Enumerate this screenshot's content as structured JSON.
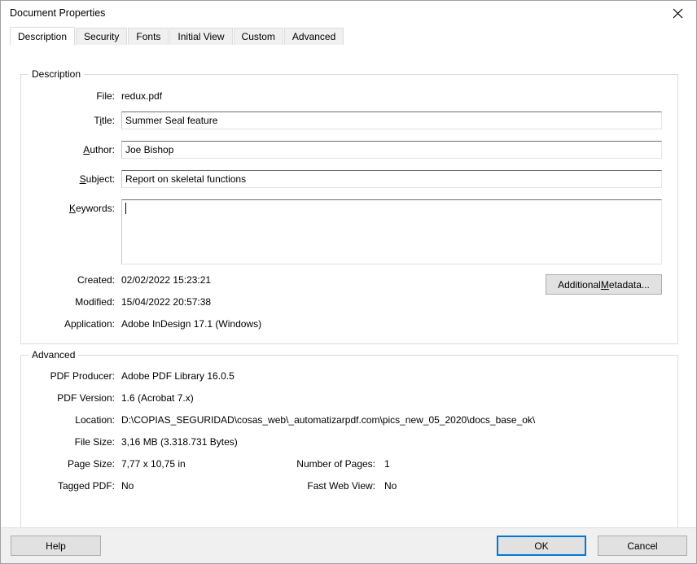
{
  "window": {
    "title": "Document Properties",
    "close_icon": "close-icon"
  },
  "tabs": [
    {
      "label": "Description",
      "selected": true
    },
    {
      "label": "Security",
      "selected": false
    },
    {
      "label": "Fonts",
      "selected": false
    },
    {
      "label": "Initial View",
      "selected": false
    },
    {
      "label": "Custom",
      "selected": false
    },
    {
      "label": "Advanced",
      "selected": false
    }
  ],
  "description": {
    "group_title": "Description",
    "file_label": "File:",
    "file_value": "redux.pdf",
    "title_label_pre": "T",
    "title_label_accel": "i",
    "title_label_post": "tle:",
    "title_value": "Summer Seal feature",
    "author_label_accel": "A",
    "author_label_post": "uthor:",
    "author_value": "Joe Bishop",
    "subject_label_accel": "S",
    "subject_label_post": "ubject:",
    "subject_value": "Report on skeletal functions",
    "keywords_label_accel": "K",
    "keywords_label_post": "eywords:",
    "keywords_value": "",
    "created_label": "Created:",
    "created_value": "02/02/2022 15:23:21",
    "modified_label": "Modified:",
    "modified_value": "15/04/2022 20:57:38",
    "application_label": "Application:",
    "application_value": "Adobe InDesign 17.1 (Windows)",
    "additional_metadata_pre": "Additional ",
    "additional_metadata_accel": "M",
    "additional_metadata_post": "etadata..."
  },
  "advanced": {
    "group_title": "Advanced",
    "pdf_producer_label": "PDF Producer:",
    "pdf_producer_value": "Adobe PDF Library 16.0.5",
    "pdf_version_label": "PDF Version:",
    "pdf_version_value": "1.6 (Acrobat 7.x)",
    "location_label": "Location:",
    "location_value": "D:\\COPIAS_SEGURIDAD\\cosas_web\\_automatizarpdf.com\\pics_new_05_2020\\docs_base_ok\\",
    "file_size_label": "File Size:",
    "file_size_value": "3,16 MB (3.318.731 Bytes)",
    "page_size_label": "Page Size:",
    "page_size_value": "7,77 x 10,75 in",
    "number_of_pages_label": "Number of Pages:",
    "number_of_pages_value": "1",
    "tagged_pdf_label": "Tagged PDF:",
    "tagged_pdf_value": "No",
    "fast_web_view_label": "Fast Web View:",
    "fast_web_view_value": "No"
  },
  "footer": {
    "help_label": "Help",
    "ok_label": "OK",
    "cancel_label": "Cancel"
  },
  "colors": {
    "accent": "#0078d7",
    "dialog_bg": "#ffffff",
    "footer_bg": "#f0f0f0",
    "button_bg": "#e1e1e1",
    "border": "#dcdcdc"
  }
}
